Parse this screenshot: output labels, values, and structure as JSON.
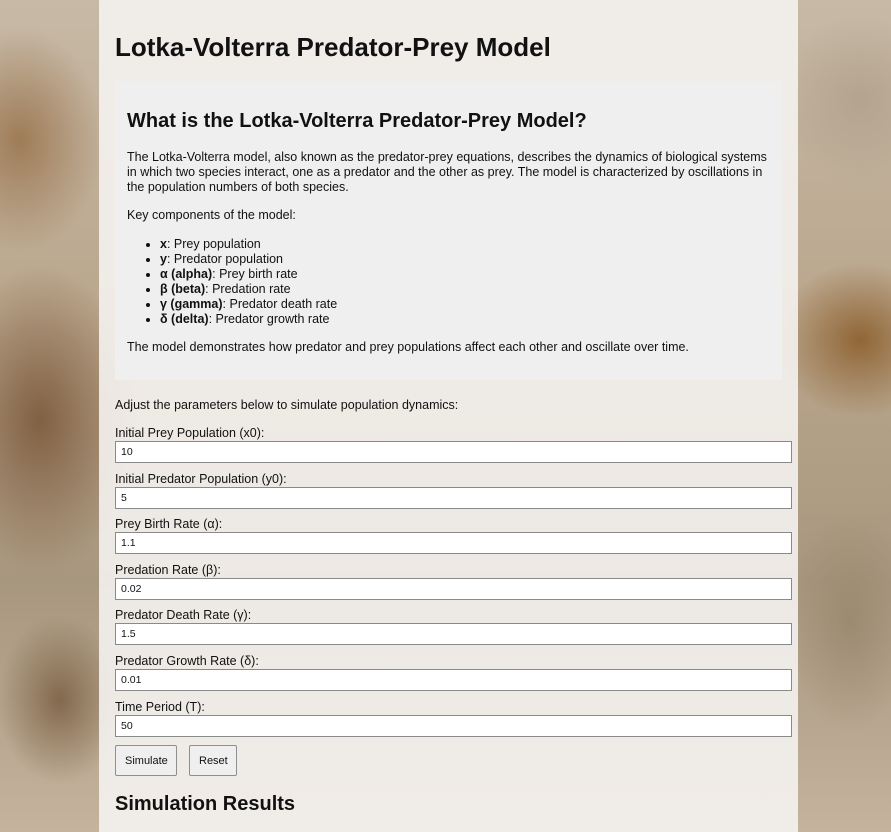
{
  "page_title": "Lotka-Volterra Predator-Prey Model",
  "info": {
    "heading": "What is the Lotka-Volterra Predator-Prey Model?",
    "paragraph1": "The Lotka-Volterra model, also known as the predator-prey equations, describes the dynamics of biological systems in which two species interact, one as a predator and the other as prey. The model is characterized by oscillations in the population numbers of both species.",
    "paragraph2": "Key components of the model:",
    "components": [
      {
        "term": "x",
        "desc": ": Prey population"
      },
      {
        "term": "y",
        "desc": ": Predator population"
      },
      {
        "term": "α (alpha)",
        "desc": ": Prey birth rate"
      },
      {
        "term": "β (beta)",
        "desc": ": Predation rate"
      },
      {
        "term": "γ (gamma)",
        "desc": ": Predator death rate"
      },
      {
        "term": "δ (delta)",
        "desc": ": Predator growth rate"
      }
    ],
    "paragraph3": "The model demonstrates how predator and prey populations affect each other and oscillate over time."
  },
  "form": {
    "intro": "Adjust the parameters below to simulate population dynamics:",
    "fields": [
      {
        "label": "Initial Prey Population (x0):",
        "value": "10"
      },
      {
        "label": "Initial Predator Population (y0):",
        "value": "5"
      },
      {
        "label": "Prey Birth Rate (α):",
        "value": "1.1"
      },
      {
        "label": "Predation Rate (β):",
        "value": "0.02"
      },
      {
        "label": "Predator Death Rate (γ):",
        "value": "1.5"
      },
      {
        "label": "Predator Growth Rate (δ):",
        "value": "0.01"
      },
      {
        "label": "Time Period (T):",
        "value": "50"
      }
    ],
    "simulate_label": "Simulate",
    "reset_label": "Reset"
  },
  "results_heading": "Simulation Results"
}
